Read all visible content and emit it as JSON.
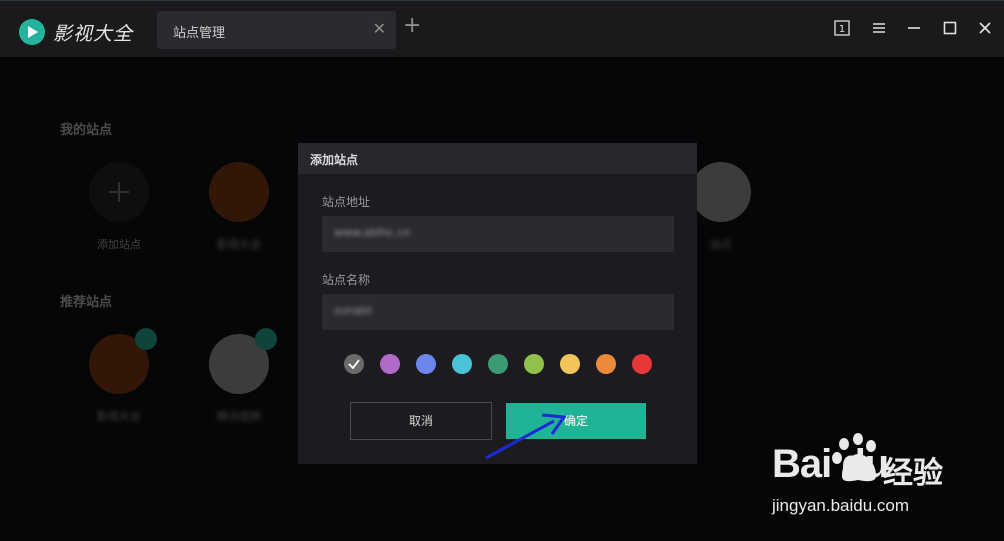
{
  "app": {
    "name": "影视大全"
  },
  "tabs": [
    {
      "label": "站点管理",
      "close": "✕"
    }
  ],
  "tab_add": "+",
  "window_controls": [
    "1",
    "menu-icon",
    "minimize-icon",
    "maximize-icon",
    "close-icon"
  ],
  "window_controls_symbols": {
    "one": "1",
    "close": "✕"
  },
  "my_sites": {
    "title": "我的站点",
    "items": [
      {
        "label": "添加站点",
        "icon": "plus-icon"
      },
      {
        "label": "影视大全",
        "color": "#e25a12"
      },
      {
        "label": "站点",
        "color": "#e8e8e8"
      }
    ]
  },
  "recommended": {
    "title": "推荐站点",
    "items": [
      {
        "label": "影视大全",
        "color": "#e25a12"
      },
      {
        "label": "腾讯视频",
        "color": "#e8e8e8"
      }
    ]
  },
  "dialog": {
    "title": "添加站点",
    "url_label": "站点地址",
    "url_value": "www.abfnc.cn",
    "name_label": "站点名称",
    "name_value": "zunabt",
    "colors": [
      "#6b6b6b",
      "#b06ac8",
      "#6d86ee",
      "#4bc3d6",
      "#3d9b74",
      "#92c04d",
      "#f1c55a",
      "#ec8a3c",
      "#e63838"
    ],
    "selected_color_index": 0,
    "cancel_label": "取消",
    "ok_label": "确定"
  },
  "watermark": {
    "brand": "Bai  du",
    "cn": "经验",
    "url": "jingyan.baidu.com"
  }
}
